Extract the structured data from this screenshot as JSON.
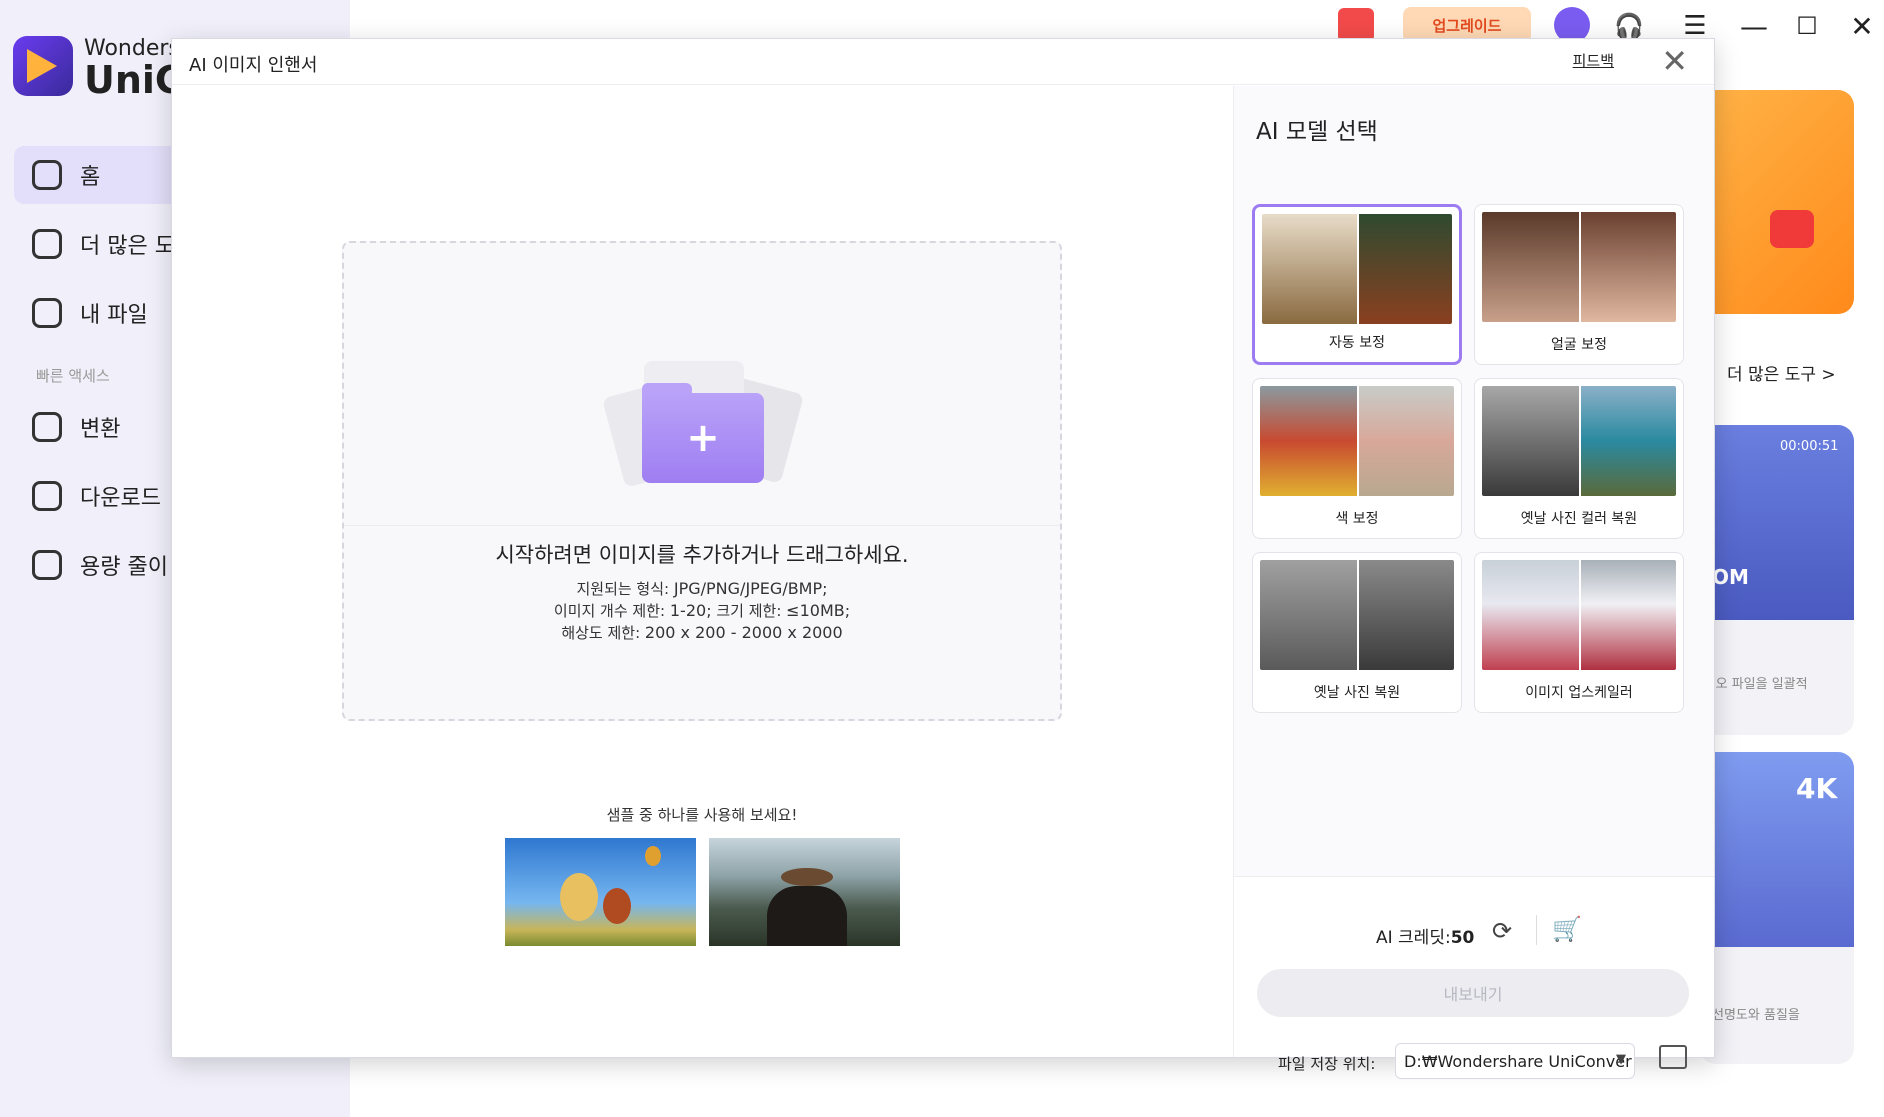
{
  "app": {
    "brand_top": "Wonders",
    "brand_bottom": "UniC",
    "nav": [
      {
        "label": "홈"
      },
      {
        "label": "더 많은 도"
      },
      {
        "label": "내 파일"
      }
    ],
    "quick_access_label": "빠른 액세스",
    "quick": [
      {
        "label": "변환"
      },
      {
        "label": "다운로드"
      },
      {
        "label": "용량 줄이"
      }
    ],
    "upgrade_label": "업그레이드",
    "more_tools": "더 많은 도구 >",
    "card_time": "00:00:51",
    "card_om": "OM",
    "card_4k": "4K",
    "side_text_1": "l오 파일을 일괄적",
    "side_text_2": "선명도와 품질을"
  },
  "dialog": {
    "title": "AI 이미지 인핸서",
    "feedback": "피드백",
    "close": "✕",
    "dropzone": {
      "main": "시작하려면 이미지를 추가하거나 드래그하세요.",
      "format_label": "지원되는 형식:",
      "format_value": "JPG/PNG/JPEG/BMP;",
      "count_label": "이미지 개수 제한:",
      "count_value": "1-20;",
      "size_label": "크기 제한:",
      "size_value": "≤10MB;",
      "res_label": "해상도 제한:",
      "res_value": "200 x 200 - 2000 x 2000"
    },
    "sample_label": "샘플 중 하나를 사용해 보세요!",
    "model_title": "AI 모델 선택",
    "models": [
      {
        "label": "자동 보정"
      },
      {
        "label": "얼굴 보정"
      },
      {
        "label": "색 보정"
      },
      {
        "label": "옛날 사진 컬러 복원"
      },
      {
        "label": "옛날 사진 복원"
      },
      {
        "label": "이미지 업스케일러"
      }
    ],
    "credit_label": "AI 크레딧:",
    "credit_value": "50",
    "export_label": "내보내기",
    "save_label": "파일 저장 위치:",
    "save_path": "D:₩Wondershare UniConver"
  },
  "colors": {
    "accent": "#9d7cf2",
    "upgrade_text": "#e24a1f",
    "cart": "#6a4cf0"
  }
}
